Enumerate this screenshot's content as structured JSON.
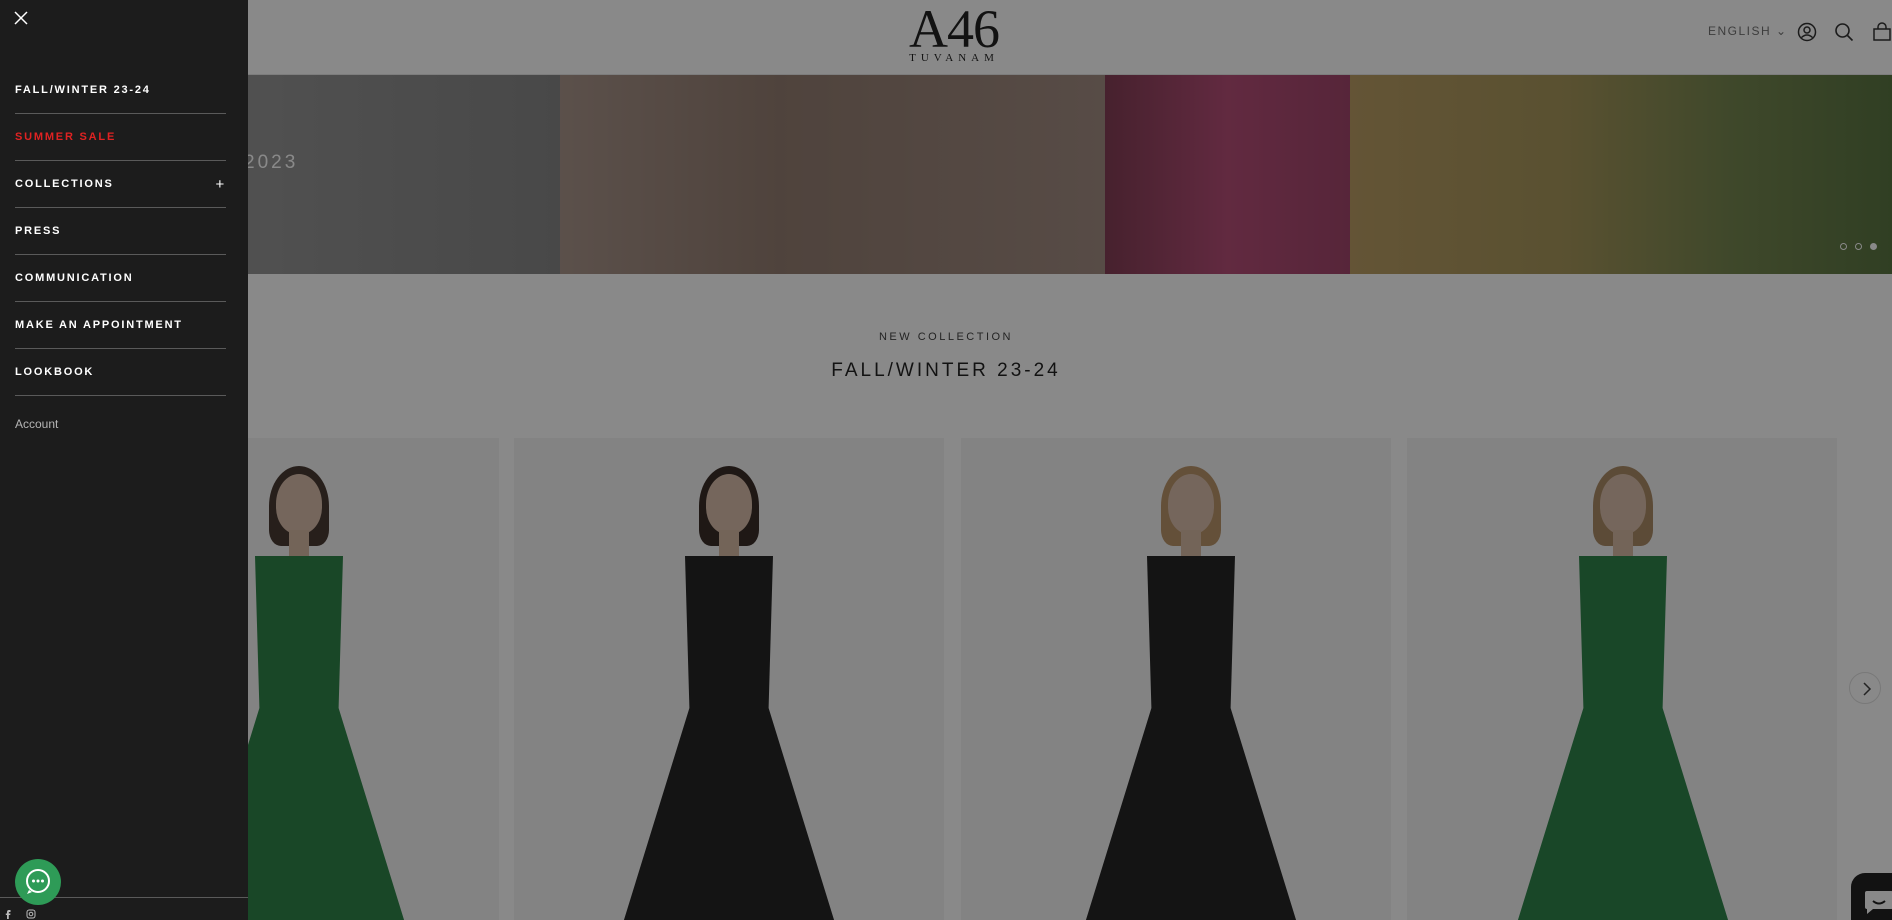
{
  "header": {
    "logo_main": "A46",
    "logo_sub": "TUVANAM",
    "language": "ENGLISH"
  },
  "hero": {
    "text": "2023",
    "slide_count": 3,
    "active_slide": 3
  },
  "section": {
    "kicker": "NEW COLLECTION",
    "title": "FALL/WINTER 23-24"
  },
  "products": [
    {
      "dress_color": "#1f7a3a"
    },
    {
      "dress_color": "#151515"
    },
    {
      "dress_color": "#141414"
    },
    {
      "dress_color": "#1e7a3c"
    }
  ],
  "drawer": {
    "menu": [
      {
        "label": "FALL/WINTER 23-24"
      },
      {
        "label": "SUMMER SALE",
        "color": "#e02222"
      },
      {
        "label": "COLLECTIONS",
        "expand": "+"
      },
      {
        "label": "PRESS"
      },
      {
        "label": "COMMUNICATION"
      },
      {
        "label": "MAKE AN APPOINTMENT"
      },
      {
        "label": "LOOKBOOK"
      }
    ],
    "account": "Account"
  },
  "colors": {
    "drawer_bg": "#1c1c1c",
    "sale": "#e02222",
    "chat": "#2e9b57"
  }
}
